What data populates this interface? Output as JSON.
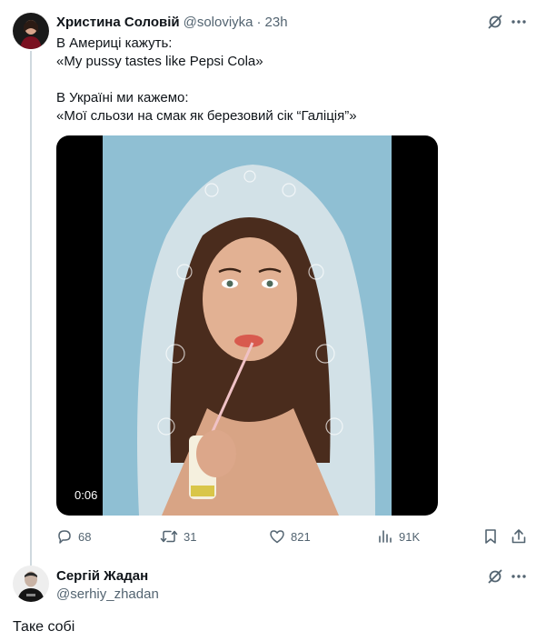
{
  "tweet1": {
    "author_name": "Христина Соловій",
    "handle": "@soloviyka",
    "separator": "·",
    "time": "23h",
    "text_lines": [
      "В Америці кажуть:",
      "«My pussy tastes like Pepsi Cola»",
      "",
      "В Україні ми кажемо:",
      "«Мої сльози на смак як березовий сік “Галіція”»"
    ],
    "video_time": "0:06",
    "stats": {
      "replies": "68",
      "reposts": "31",
      "likes": "821",
      "views": "91K"
    }
  },
  "tweet2": {
    "author_name": "Сергій Жадан",
    "handle": "@serhiy_zhadan",
    "text": "Таке собі"
  },
  "icons": {
    "grok": "grok-icon",
    "more": "more-icon",
    "reply": "reply-icon",
    "repost": "repost-icon",
    "like": "heart-icon",
    "views": "views-icon",
    "bookmark": "bookmark-icon",
    "share": "share-icon"
  },
  "colors": {
    "text": "#0f1419",
    "secondary": "#536471",
    "thread_line": "#cfd9de",
    "photo_background": "#8fbfd3"
  }
}
